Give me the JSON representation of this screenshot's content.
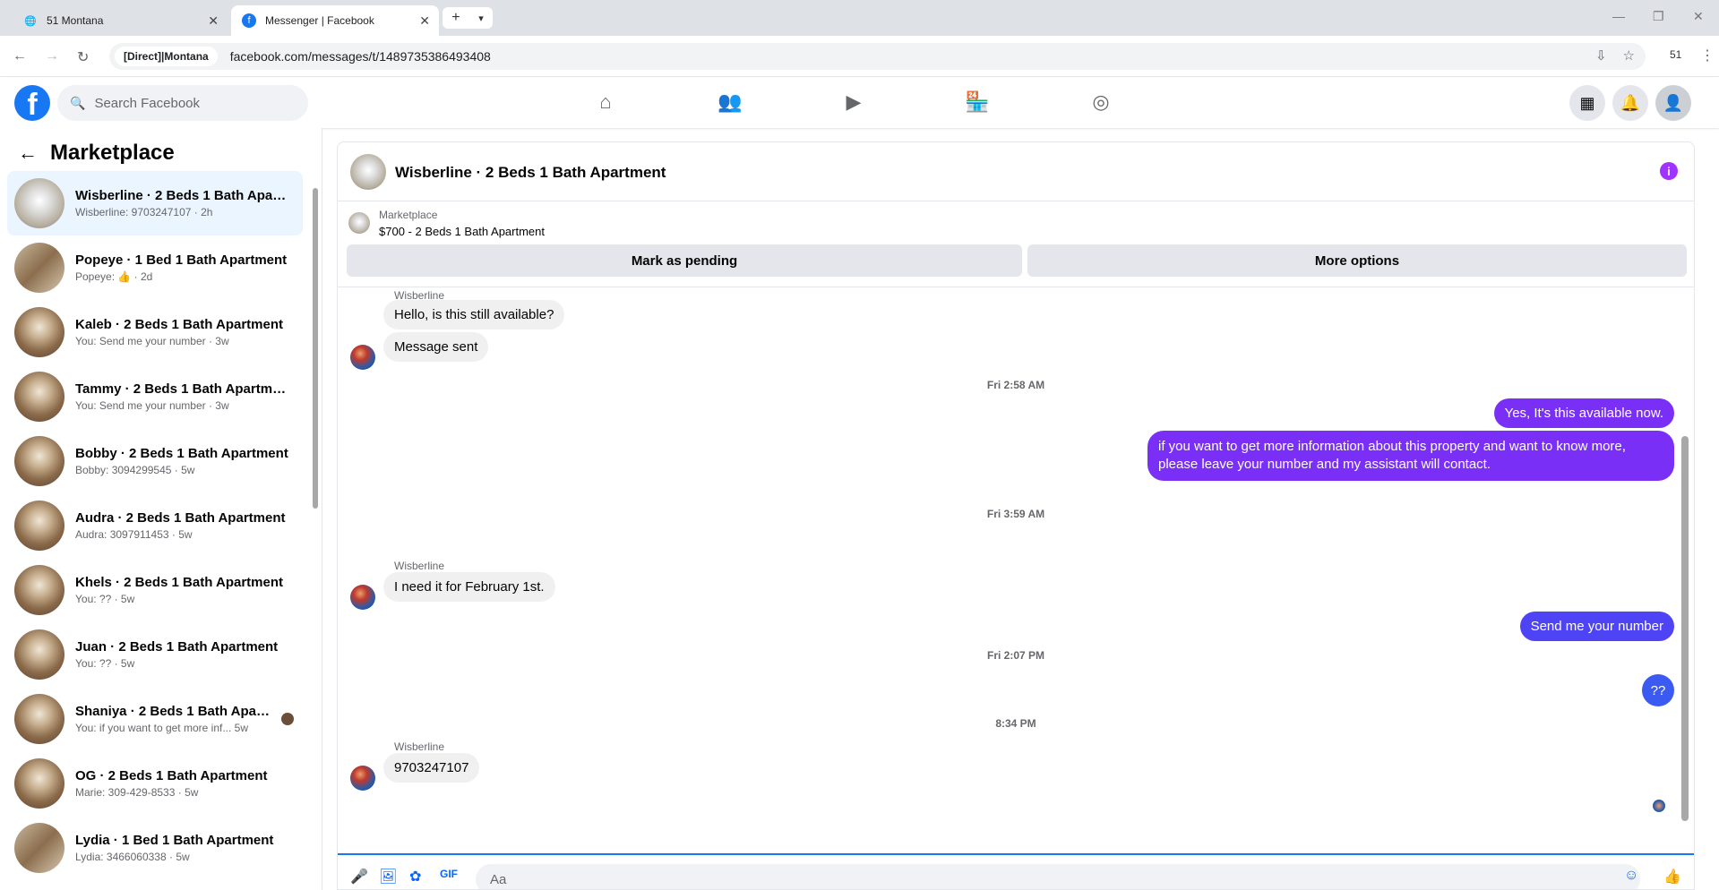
{
  "browser": {
    "tabs": [
      {
        "title": "51 Montana",
        "active": false
      },
      {
        "title": "Messenger | Facebook",
        "active": true
      }
    ],
    "proxy_chip": "[Direct]|Montana",
    "url": "facebook.com/messages/t/1489735386493408",
    "profile_count": "51"
  },
  "facebook": {
    "logo": "f",
    "search_placeholder": "Search Facebook",
    "nav_icons": [
      "home-icon",
      "friends-icon",
      "video-icon",
      "marketplace-icon",
      "groups-icon"
    ]
  },
  "sidebar": {
    "title": "Marketplace",
    "conversations": [
      {
        "name": "Wisberline · 2 Beds 1 Bath Apart...",
        "preview": "Wisberline: 9703247107 · 2h",
        "active": true
      },
      {
        "name": "Popeye · 1 Bed 1 Bath Apartment",
        "preview": "Popeye: 👍 · 2d",
        "active": false
      },
      {
        "name": "Kaleb · 2 Beds 1 Bath Apartment",
        "preview": "You: Send me your number · 3w",
        "active": false
      },
      {
        "name": "Tammy · 2 Beds 1 Bath Apartment",
        "preview": "You: Send me your number · 3w",
        "active": false
      },
      {
        "name": "Bobby · 2 Beds 1 Bath Apartment",
        "preview": "Bobby: 3094299545 · 5w",
        "active": false
      },
      {
        "name": "Audra · 2 Beds 1 Bath Apartment",
        "preview": "Audra: 3097911453 · 5w",
        "active": false
      },
      {
        "name": "Khels · 2 Beds 1 Bath Apartment",
        "preview": "You: ?? · 5w",
        "active": false
      },
      {
        "name": "Juan · 2 Beds 1 Bath Apartment",
        "preview": "You: ?? · 5w",
        "active": false
      },
      {
        "name": "Shaniya · 2 Beds 1 Bath Apart...",
        "preview": "You: if you want to get more inf...  5w",
        "active": false
      },
      {
        "name": "OG · 2 Beds 1 Bath Apartment",
        "preview": "Marie: 309-429-8533 · 5w",
        "active": false
      },
      {
        "name": "Lydia · 1 Bed 1 Bath Apartment",
        "preview": "Lydia: 3466060338 · 5w",
        "active": false
      }
    ]
  },
  "chat": {
    "title": "Wisberline · 2 Beds 1 Bath Apartment",
    "marketplace_label": "Marketplace",
    "listing": "$700 - 2 Beds 1 Bath Apartment",
    "mark_pending": "Mark as pending",
    "more_options": "More options",
    "messages": [
      {
        "type": "sender",
        "text": "Wisberline"
      },
      {
        "type": "in",
        "text": "Hello, is this still available?"
      },
      {
        "type": "in",
        "text": "Message sent"
      },
      {
        "type": "time",
        "text": "Fri 2:58 AM"
      },
      {
        "type": "out",
        "text": "Yes, It's this available now."
      },
      {
        "type": "out",
        "text": "if you want to get more information about this property and want to know more, please leave your number and my assistant will contact."
      },
      {
        "type": "time",
        "text": "Fri 3:59 AM"
      },
      {
        "type": "sender",
        "text": "Wisberline"
      },
      {
        "type": "in",
        "text": "I need it for February 1st."
      },
      {
        "type": "out",
        "text": "Send me your number"
      },
      {
        "type": "time",
        "text": "Fri 2:07 PM"
      },
      {
        "type": "out",
        "text": "??"
      },
      {
        "type": "time",
        "text": "8:34 PM"
      },
      {
        "type": "sender",
        "text": "Wisberline"
      },
      {
        "type": "in",
        "text": "9703247107"
      }
    ],
    "composer_placeholder": "Aa",
    "out_bubble_colors": [
      "#7a2ff7",
      "#4f44f5",
      "#3a5af2"
    ]
  }
}
